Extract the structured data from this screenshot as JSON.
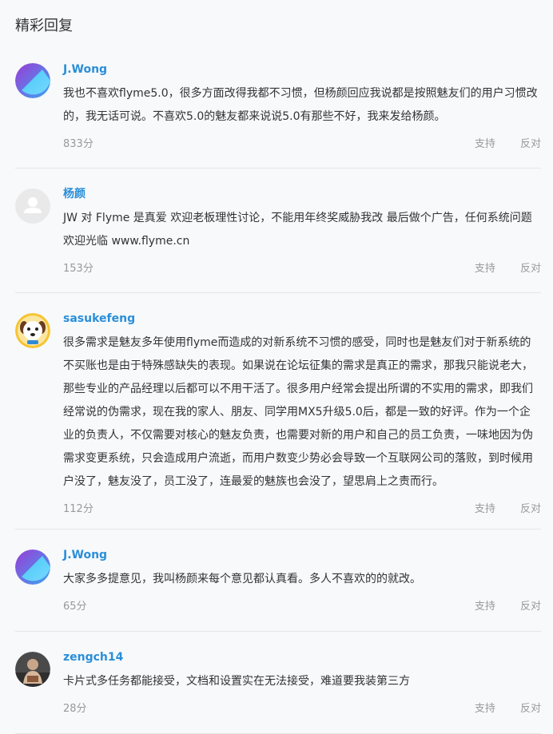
{
  "section": {
    "title": "精彩回复"
  },
  "comments": [
    {
      "username": "J.Wong",
      "avatar_icon": "flyme-logo-icon",
      "text": "我也不喜欢flyme5.0，很多方面改得我都不习惯，但杨颜回应我说都是按照魅友们的用户习惯改的，我无话可说。不喜欢5.0的魅友都来说说5.0有那些不好，我来发给杨颜。",
      "score": "833分",
      "support": "支持",
      "oppose": "反对"
    },
    {
      "username": "杨颜",
      "avatar_icon": "default-user-icon",
      "text": "JW 对 Flyme 是真爱 欢迎老板理性讨论，不能用年终奖威胁我改 最后做个广告，任何系统问题欢迎光临 www.flyme.cn",
      "score": "153分",
      "support": "支持",
      "oppose": "反对"
    },
    {
      "username": "sasukefeng",
      "avatar_icon": "dog-face-icon",
      "text": "很多需求是魅友多年使用flyme而造成的对新系统不习惯的感受，同时也是魅友们对于新系统的不买账也是由于特殊感缺失的表现。如果说在论坛征集的需求是真正的需求，那我只能说老大，那些专业的产品经理以后都可以不用干活了。很多用户经常会提出所谓的不实用的需求，即我们经常说的伪需求，现在我的家人、朋友、同学用MX5升级5.0后，都是一致的好评。作为一个企业的负责人，不仅需要对核心的魅友负责，也需要对新的用户和自己的员工负责，一味地因为伪需求变更系统，只会造成用户流逝，而用户数变少势必会导致一个互联网公司的落败，到时候用户没了，魅友没了，员工没了，连最爱的魅族也会没了，望思肩上之责而行。",
      "score": "112分",
      "support": "支持",
      "oppose": "反对"
    },
    {
      "username": "J.Wong",
      "avatar_icon": "flyme-logo-icon",
      "text": "大家多多提意见，我叫杨颜来每个意见都认真看。多人不喜欢的的就改。",
      "score": "65分",
      "support": "支持",
      "oppose": "反对"
    },
    {
      "username": "zengch14",
      "avatar_icon": "photo-avatar-icon",
      "text": "卡片式多任务都能接受，文档和设置实在无法接受，难道要我装第三方",
      "score": "28分",
      "support": "支持",
      "oppose": "反对"
    }
  ]
}
